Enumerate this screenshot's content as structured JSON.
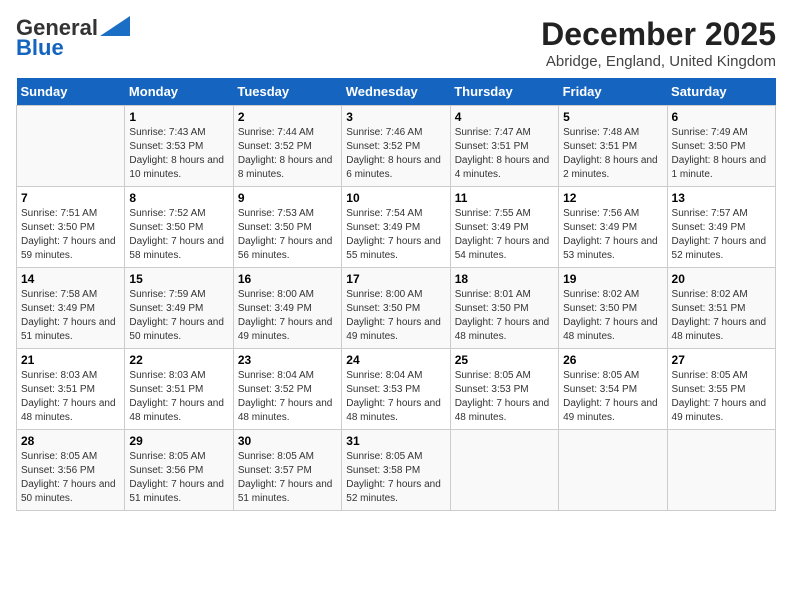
{
  "logo": {
    "line1": "General",
    "line2": "Blue"
  },
  "title": "December 2025",
  "subtitle": "Abridge, England, United Kingdom",
  "days_of_week": [
    "Sunday",
    "Monday",
    "Tuesday",
    "Wednesday",
    "Thursday",
    "Friday",
    "Saturday"
  ],
  "weeks": [
    [
      {
        "num": "",
        "sunrise": "",
        "sunset": "",
        "daylight": ""
      },
      {
        "num": "1",
        "sunrise": "Sunrise: 7:43 AM",
        "sunset": "Sunset: 3:53 PM",
        "daylight": "Daylight: 8 hours and 10 minutes."
      },
      {
        "num": "2",
        "sunrise": "Sunrise: 7:44 AM",
        "sunset": "Sunset: 3:52 PM",
        "daylight": "Daylight: 8 hours and 8 minutes."
      },
      {
        "num": "3",
        "sunrise": "Sunrise: 7:46 AM",
        "sunset": "Sunset: 3:52 PM",
        "daylight": "Daylight: 8 hours and 6 minutes."
      },
      {
        "num": "4",
        "sunrise": "Sunrise: 7:47 AM",
        "sunset": "Sunset: 3:51 PM",
        "daylight": "Daylight: 8 hours and 4 minutes."
      },
      {
        "num": "5",
        "sunrise": "Sunrise: 7:48 AM",
        "sunset": "Sunset: 3:51 PM",
        "daylight": "Daylight: 8 hours and 2 minutes."
      },
      {
        "num": "6",
        "sunrise": "Sunrise: 7:49 AM",
        "sunset": "Sunset: 3:50 PM",
        "daylight": "Daylight: 8 hours and 1 minute."
      }
    ],
    [
      {
        "num": "7",
        "sunrise": "Sunrise: 7:51 AM",
        "sunset": "Sunset: 3:50 PM",
        "daylight": "Daylight: 7 hours and 59 minutes."
      },
      {
        "num": "8",
        "sunrise": "Sunrise: 7:52 AM",
        "sunset": "Sunset: 3:50 PM",
        "daylight": "Daylight: 7 hours and 58 minutes."
      },
      {
        "num": "9",
        "sunrise": "Sunrise: 7:53 AM",
        "sunset": "Sunset: 3:50 PM",
        "daylight": "Daylight: 7 hours and 56 minutes."
      },
      {
        "num": "10",
        "sunrise": "Sunrise: 7:54 AM",
        "sunset": "Sunset: 3:49 PM",
        "daylight": "Daylight: 7 hours and 55 minutes."
      },
      {
        "num": "11",
        "sunrise": "Sunrise: 7:55 AM",
        "sunset": "Sunset: 3:49 PM",
        "daylight": "Daylight: 7 hours and 54 minutes."
      },
      {
        "num": "12",
        "sunrise": "Sunrise: 7:56 AM",
        "sunset": "Sunset: 3:49 PM",
        "daylight": "Daylight: 7 hours and 53 minutes."
      },
      {
        "num": "13",
        "sunrise": "Sunrise: 7:57 AM",
        "sunset": "Sunset: 3:49 PM",
        "daylight": "Daylight: 7 hours and 52 minutes."
      }
    ],
    [
      {
        "num": "14",
        "sunrise": "Sunrise: 7:58 AM",
        "sunset": "Sunset: 3:49 PM",
        "daylight": "Daylight: 7 hours and 51 minutes."
      },
      {
        "num": "15",
        "sunrise": "Sunrise: 7:59 AM",
        "sunset": "Sunset: 3:49 PM",
        "daylight": "Daylight: 7 hours and 50 minutes."
      },
      {
        "num": "16",
        "sunrise": "Sunrise: 8:00 AM",
        "sunset": "Sunset: 3:49 PM",
        "daylight": "Daylight: 7 hours and 49 minutes."
      },
      {
        "num": "17",
        "sunrise": "Sunrise: 8:00 AM",
        "sunset": "Sunset: 3:50 PM",
        "daylight": "Daylight: 7 hours and 49 minutes."
      },
      {
        "num": "18",
        "sunrise": "Sunrise: 8:01 AM",
        "sunset": "Sunset: 3:50 PM",
        "daylight": "Daylight: 7 hours and 48 minutes."
      },
      {
        "num": "19",
        "sunrise": "Sunrise: 8:02 AM",
        "sunset": "Sunset: 3:50 PM",
        "daylight": "Daylight: 7 hours and 48 minutes."
      },
      {
        "num": "20",
        "sunrise": "Sunrise: 8:02 AM",
        "sunset": "Sunset: 3:51 PM",
        "daylight": "Daylight: 7 hours and 48 minutes."
      }
    ],
    [
      {
        "num": "21",
        "sunrise": "Sunrise: 8:03 AM",
        "sunset": "Sunset: 3:51 PM",
        "daylight": "Daylight: 7 hours and 48 minutes."
      },
      {
        "num": "22",
        "sunrise": "Sunrise: 8:03 AM",
        "sunset": "Sunset: 3:51 PM",
        "daylight": "Daylight: 7 hours and 48 minutes."
      },
      {
        "num": "23",
        "sunrise": "Sunrise: 8:04 AM",
        "sunset": "Sunset: 3:52 PM",
        "daylight": "Daylight: 7 hours and 48 minutes."
      },
      {
        "num": "24",
        "sunrise": "Sunrise: 8:04 AM",
        "sunset": "Sunset: 3:53 PM",
        "daylight": "Daylight: 7 hours and 48 minutes."
      },
      {
        "num": "25",
        "sunrise": "Sunrise: 8:05 AM",
        "sunset": "Sunset: 3:53 PM",
        "daylight": "Daylight: 7 hours and 48 minutes."
      },
      {
        "num": "26",
        "sunrise": "Sunrise: 8:05 AM",
        "sunset": "Sunset: 3:54 PM",
        "daylight": "Daylight: 7 hours and 49 minutes."
      },
      {
        "num": "27",
        "sunrise": "Sunrise: 8:05 AM",
        "sunset": "Sunset: 3:55 PM",
        "daylight": "Daylight: 7 hours and 49 minutes."
      }
    ],
    [
      {
        "num": "28",
        "sunrise": "Sunrise: 8:05 AM",
        "sunset": "Sunset: 3:56 PM",
        "daylight": "Daylight: 7 hours and 50 minutes."
      },
      {
        "num": "29",
        "sunrise": "Sunrise: 8:05 AM",
        "sunset": "Sunset: 3:56 PM",
        "daylight": "Daylight: 7 hours and 51 minutes."
      },
      {
        "num": "30",
        "sunrise": "Sunrise: 8:05 AM",
        "sunset": "Sunset: 3:57 PM",
        "daylight": "Daylight: 7 hours and 51 minutes."
      },
      {
        "num": "31",
        "sunrise": "Sunrise: 8:05 AM",
        "sunset": "Sunset: 3:58 PM",
        "daylight": "Daylight: 7 hours and 52 minutes."
      },
      {
        "num": "",
        "sunrise": "",
        "sunset": "",
        "daylight": ""
      },
      {
        "num": "",
        "sunrise": "",
        "sunset": "",
        "daylight": ""
      },
      {
        "num": "",
        "sunrise": "",
        "sunset": "",
        "daylight": ""
      }
    ]
  ]
}
